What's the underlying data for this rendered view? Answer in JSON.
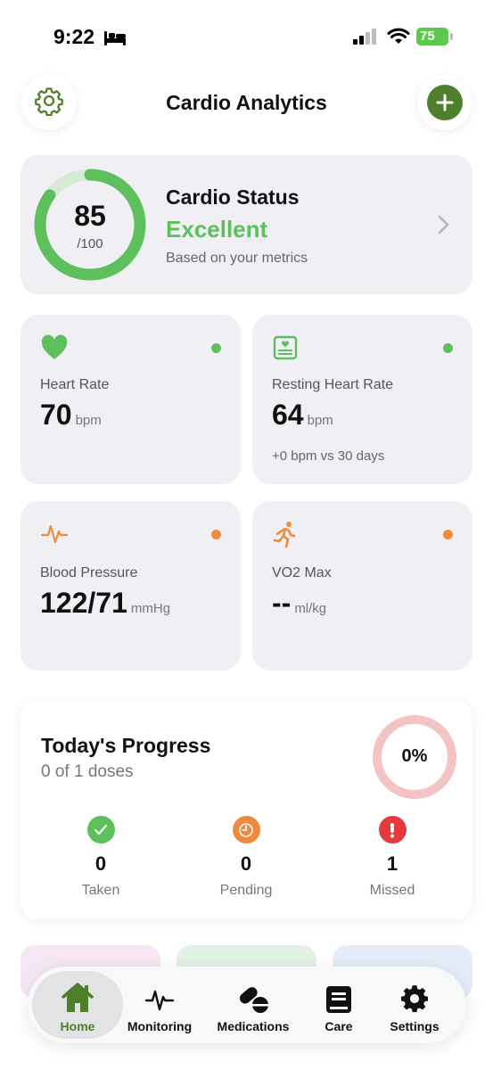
{
  "status_bar": {
    "time": "9:22",
    "battery": "75"
  },
  "header": {
    "title": "Cardio Analytics"
  },
  "cardio_status": {
    "score": "85",
    "score_max": "/100",
    "score_fraction": 0.85,
    "title": "Cardio Status",
    "rating": "Excellent",
    "subtitle": "Based on your metrics"
  },
  "metrics": [
    {
      "label": "Heart Rate",
      "value": "70",
      "unit": "bpm",
      "note": "",
      "status_color": "#5dc05c",
      "icon": "heart-icon"
    },
    {
      "label": "Resting Heart Rate",
      "value": "64",
      "unit": "bpm",
      "note": "+0 bpm vs 30 days",
      "status_color": "#5dc05c",
      "icon": "heart-monitor-icon"
    },
    {
      "label": "Blood Pressure",
      "value": "122/71",
      "unit": "mmHg",
      "note": "",
      "status_color": "#f08a3c",
      "icon": "pulse-icon"
    },
    {
      "label": "VO2 Max",
      "value": "--",
      "unit": "ml/kg",
      "note": "",
      "status_color": "#f08a3c",
      "icon": "running-icon"
    }
  ],
  "progress": {
    "title": "Today's Progress",
    "subtitle": "0 of 1 doses",
    "percent": "0%",
    "stats": [
      {
        "label": "Taken",
        "value": "0",
        "color": "#5dc05c",
        "icon": "check-icon"
      },
      {
        "label": "Pending",
        "value": "0",
        "color": "#f08a3c",
        "icon": "clock-icon"
      },
      {
        "label": "Missed",
        "value": "1",
        "color": "#e5393c",
        "icon": "alert-icon"
      }
    ]
  },
  "tabs": [
    {
      "label": "Home",
      "icon": "home-icon",
      "active": true
    },
    {
      "label": "Monitoring",
      "icon": "monitoring-icon"
    },
    {
      "label": "Medications",
      "icon": "pills-icon"
    },
    {
      "label": "Care",
      "icon": "care-icon"
    },
    {
      "label": "Settings",
      "icon": "settings-gear-icon"
    }
  ],
  "colors": {
    "accent": "#4f7f2a",
    "good": "#5dc05c",
    "warning": "#f08a3c",
    "danger": "#e5393c",
    "card": "#f0f0f4"
  }
}
